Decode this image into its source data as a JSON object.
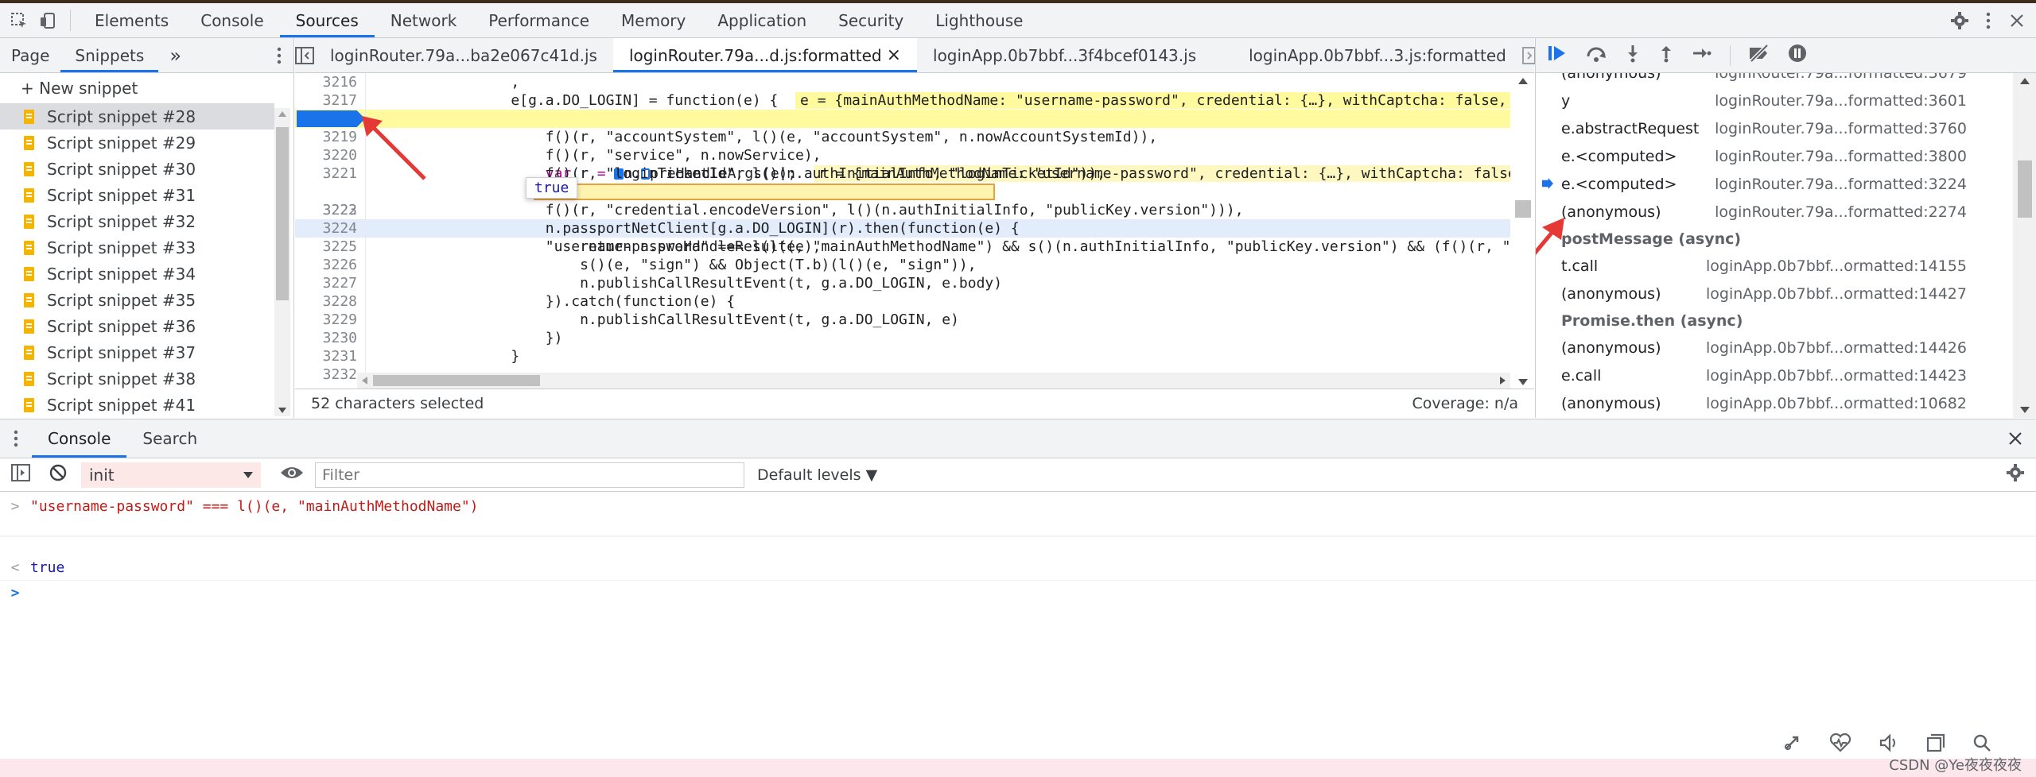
{
  "toolbar": {
    "tabs": [
      "Elements",
      "Console",
      "Sources",
      "Network",
      "Performance",
      "Memory",
      "Application",
      "Security",
      "Lighthouse"
    ],
    "active_tab": "Sources"
  },
  "navigator": {
    "tabs": [
      "Page",
      "Snippets"
    ],
    "more": "»",
    "new_snippet": "+ New snippet",
    "snippets": [
      "Script snippet #28",
      "Script snippet #29",
      "Script snippet #30",
      "Script snippet #31",
      "Script snippet #32",
      "Script snippet #33",
      "Script snippet #34",
      "Script snippet #35",
      "Script snippet #36",
      "Script snippet #37",
      "Script snippet #38",
      "Script snippet #41"
    ]
  },
  "editor": {
    "tabs": [
      {
        "label": "loginRouter.79a...ba2e067c41d.js",
        "active": false
      },
      {
        "label": "loginRouter.79a...d.js:formatted",
        "active": true,
        "close": "×"
      },
      {
        "label": "loginApp.0b7bbf...3f4bcef0143.js",
        "active": false
      },
      {
        "label": "loginApp.0b7bbf...3.js:formatted",
        "active": false
      }
    ],
    "lines": [
      {
        "n": "3216",
        "code": "                ,"
      },
      {
        "n": "3217",
        "code": "                e[g.a.DO_LOGIN] = function(e) {  ",
        "inline": "e = {mainAuthMethodName: \"username-password\", credential: {…}, withCaptcha: false, s"
      },
      {
        "n": "3218",
        "code": "                    var r = ",
        "code2": "n.",
        "code3": "preHandleArgs(e);  ",
        "inline": "r = {mainAuthMethodName: \"username-password\", credential: {…}, withCaptcha: false"
      },
      {
        "n": "3219",
        "code": "                    f()(r, \"accountSystem\", l()(e, \"accountSystem\", n.nowAccountSystemId)),"
      },
      {
        "n": "3220",
        "code": "                    f()(r, \"service\", n.nowService),"
      },
      {
        "n": "3221",
        "code": "                    f()(r, \"loginTicketId\", l()(n.authInitialInfo, \"loginTicketId\")),"
      },
      {
        "n": "3222",
        "code": "                    \"username-password\" === l()(e, \"mainAuthMethodName\") && s()(n.authInitialInfo, \"publicKey.version\") && (f()(r, \"c"
      },
      {
        "n": "3223",
        "code": "                    f()(r, \"credential.encodeVersion\", l()(n.authInitialInfo, \"publicKey.version\"))),"
      },
      {
        "n": "3224",
        "code": "                    n.passportNetClient[g.a.DO_LOGIN](r).then(function(e) {"
      },
      {
        "n": "3225",
        "code": "                        return n.preHandleResult(e),"
      },
      {
        "n": "3226",
        "code": "                        s()(e, \"sign\") && Object(T.b)(l()(e, \"sign\")),"
      },
      {
        "n": "3227",
        "code": "                        n.publishCallResultEvent(t, g.a.DO_LOGIN, e.body)"
      },
      {
        "n": "3228",
        "code": "                    }).catch(function(e) {"
      },
      {
        "n": "3229",
        "code": "                        n.publishCallResultEvent(t, g.a.DO_LOGIN, e)"
      },
      {
        "n": "3230",
        "code": "                    })"
      },
      {
        "n": "3231",
        "code": "                }"
      },
      {
        "n": "3232",
        "code": ""
      }
    ],
    "tooltip": "true",
    "status_left": "52 characters selected",
    "status_right": "Coverage: n/a"
  },
  "call_stack": {
    "frames": [
      {
        "fn": "(anonymous)",
        "loc": "loginRouter.79a...formatted:3679"
      },
      {
        "fn": "y",
        "loc": "loginRouter.79a...formatted:3601"
      },
      {
        "fn": "e.abstractRequest",
        "loc": "loginRouter.79a...formatted:3760"
      },
      {
        "fn": "e.<computed>",
        "loc": "loginRouter.79a...formatted:3800"
      },
      {
        "fn": "e.<computed>",
        "loc": "loginRouter.79a...formatted:3224",
        "current": true
      },
      {
        "fn": "(anonymous)",
        "loc": "loginRouter.79a...formatted:2274"
      },
      {
        "async": "postMessage (async)"
      },
      {
        "fn": "t.call",
        "loc": "loginApp.0b7bbf...ormatted:14155"
      },
      {
        "fn": "(anonymous)",
        "loc": "loginApp.0b7bbf...ormatted:14427"
      },
      {
        "async": "Promise.then (async)"
      },
      {
        "fn": "(anonymous)",
        "loc": "loginApp.0b7bbf...ormatted:14426"
      },
      {
        "fn": "e.call",
        "loc": "loginApp.0b7bbf...ormatted:14423"
      },
      {
        "fn": "(anonymous)",
        "loc": "loginApp.0b7bbf...ormatted:10682"
      }
    ]
  },
  "drawer": {
    "tabs": [
      "Console",
      "Search"
    ],
    "context": "init",
    "filter_placeholder": "Filter",
    "levels": "Default levels ▼"
  },
  "console": {
    "input_expr": "\"username-password\" === l()(e, \"mainAuthMethodName\")",
    "result": "true",
    "prompt": ">",
    "out_glyph": "<"
  },
  "watermark": "CSDN @Ye夜夜夜夜"
}
